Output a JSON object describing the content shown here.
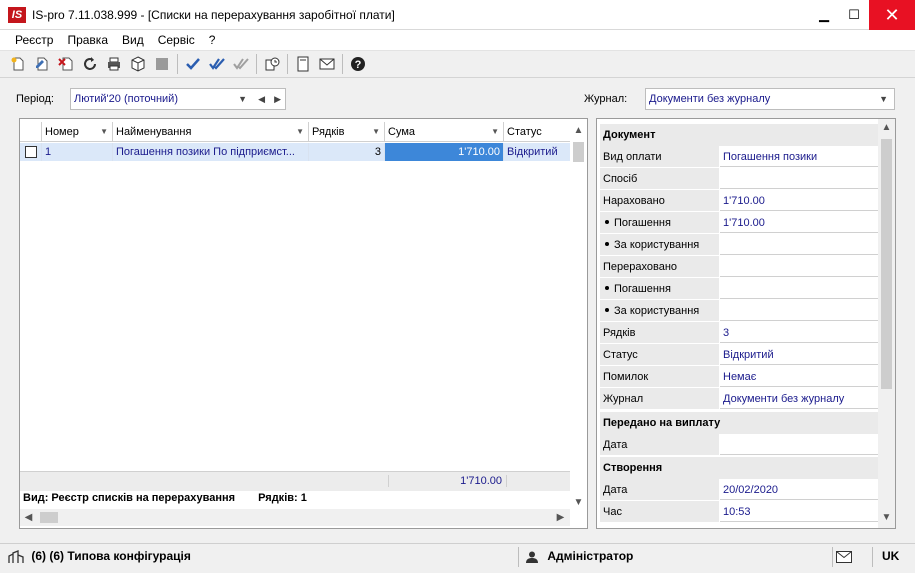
{
  "window": {
    "logo": "IS",
    "title": "IS-pro 7.11.038.999 - [Списки на перерахування заробітної плати]",
    "minimize": "▁",
    "maximize": "☐",
    "close": "✕"
  },
  "menu": [
    "Реєстр",
    "Правка",
    "Вид",
    "Сервіс",
    "?"
  ],
  "toolbar_icons": [
    "new-doc-icon",
    "edit-doc-icon",
    "delete-doc-icon",
    "refresh-icon",
    "print-icon",
    "package-icon",
    "disabled-icon",
    "check-icon",
    "double-check-icon",
    "check-disabled-icon",
    "clock-icon",
    "document-icon",
    "mail-icon",
    "help-icon"
  ],
  "filter": {
    "period_label": "Період:",
    "period_value": "Лютий'20 (поточний)",
    "journal_label": "Журнал:",
    "journal_value": "Документи без журналу"
  },
  "grid": {
    "columns": [
      "Номер",
      "Найменування",
      "Рядків",
      "Сума",
      "Статус"
    ],
    "rows": [
      {
        "number": "1",
        "name": "Погашення позики По підприємст...",
        "rows": "3",
        "sum": "1'710.00",
        "status": "Відкритий"
      }
    ],
    "footer_sum": "1'710.00",
    "status_view": "Вид: Реєстр списків на перерахування",
    "status_rows": "Рядків: 1"
  },
  "panel": {
    "section_document": "Документ",
    "fields": [
      {
        "key": "Вид оплати",
        "value": "Погашення позики",
        "bullet": false
      },
      {
        "key": "Спосіб",
        "value": "",
        "bullet": false
      },
      {
        "key": "Нараховано",
        "value": "1'710.00",
        "bullet": false
      },
      {
        "key": "Погашення",
        "value": "1'710.00",
        "bullet": true
      },
      {
        "key": "За користування",
        "value": "",
        "bullet": true
      },
      {
        "key": "Перераховано",
        "value": "",
        "bullet": false
      },
      {
        "key": "Погашення",
        "value": "",
        "bullet": true
      },
      {
        "key": "За користування",
        "value": "",
        "bullet": true
      },
      {
        "key": "Рядків",
        "value": "3",
        "bullet": false
      },
      {
        "key": "Статус",
        "value": "Відкритий",
        "bullet": false
      },
      {
        "key": "Помилок",
        "value": "Немає",
        "bullet": false
      },
      {
        "key": "Журнал",
        "value": "Документи без журналу",
        "bullet": false
      }
    ],
    "section_payout": "Передано на виплату",
    "payout_date_key": "Дата",
    "payout_date_value": "",
    "section_created": "Створення",
    "created_date_key": "Дата",
    "created_date_value": "20/02/2020",
    "created_time_key": "Час",
    "created_time_value": "10:53"
  },
  "statusbar": {
    "config": "(6) (6) Типова конфігурація",
    "user": "Адміністратор",
    "lang": "UK"
  }
}
